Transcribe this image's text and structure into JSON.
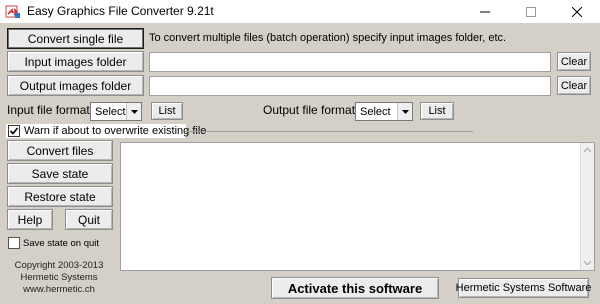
{
  "window": {
    "title": "Easy Graphics File Converter 9.21t"
  },
  "toolbar": {
    "convert_single_label": "Convert single file",
    "batch_hint": "To convert multiple files (batch operation) specify input images folder, etc.",
    "input_folder_label": "Input images folder",
    "output_folder_label": "Output images folder",
    "input_folder_value": "",
    "output_folder_value": "",
    "clear_label": "Clear"
  },
  "formats": {
    "input_label": "Input file format:",
    "output_label": "Output file format:",
    "input_selected": "Select",
    "output_selected": "Select",
    "list_label": "List"
  },
  "options": {
    "warn_overwrite_label": "Warn if about to overwrite existing file",
    "warn_overwrite_checked": true,
    "save_state_on_quit_label": "Save state on quit",
    "save_state_on_quit_checked": false
  },
  "actions": {
    "convert_files": "Convert files",
    "save_state": "Save state",
    "restore_state": "Restore state",
    "help": "Help",
    "quit": "Quit",
    "activate": "Activate this software",
    "hermetic": "Hermetic Systems Software"
  },
  "footer": {
    "copyright": "Copyright 2003-2013",
    "company": "Hermetic Systems",
    "website": "www.hermetic.ch"
  },
  "log": {
    "text": ""
  },
  "icons": {
    "app": "app-icon",
    "minimize": "minimize-icon",
    "maximize": "maximize-icon",
    "close": "close-icon"
  }
}
